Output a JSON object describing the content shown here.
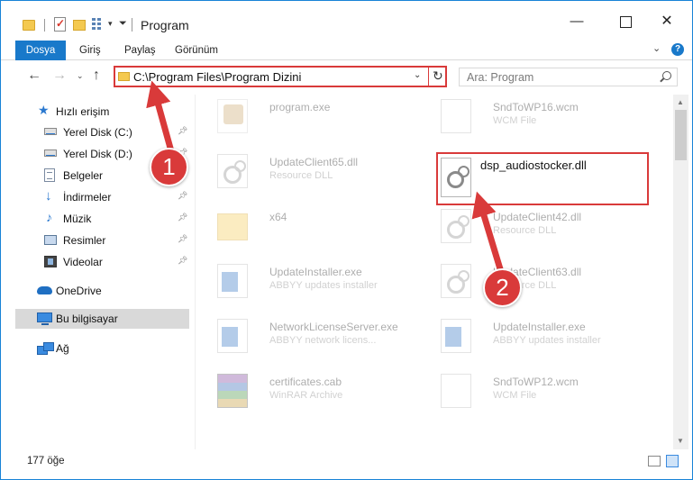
{
  "window": {
    "title": "Program",
    "minimize": "—",
    "close": "✕"
  },
  "ribbon": {
    "tabs": [
      "Dosya",
      "Giriş",
      "Paylaş",
      "Görünüm"
    ],
    "help": "?"
  },
  "nav": {
    "back": "←",
    "forward": "→",
    "recent": "⌄",
    "up": "↑",
    "address": "C:\\Program Files\\Program Dizini",
    "refresh": "↻",
    "search_placeholder": "Ara: Program"
  },
  "sidebar": {
    "quick_access": "Hızlı erişim",
    "items": [
      {
        "label": "Yerel Disk (C:)",
        "icon": "drive-icon",
        "pinned": true
      },
      {
        "label": "Yerel Disk (D:)",
        "icon": "drive-icon",
        "pinned": true
      },
      {
        "label": "Belgeler",
        "icon": "documents-icon",
        "pinned": true
      },
      {
        "label": "İndirmeler",
        "icon": "downloads-icon",
        "pinned": true
      },
      {
        "label": "Müzik",
        "icon": "music-icon",
        "pinned": true
      },
      {
        "label": "Resimler",
        "icon": "pictures-icon",
        "pinned": true
      },
      {
        "label": "Videolar",
        "icon": "videos-icon",
        "pinned": true
      }
    ],
    "onedrive": "OneDrive",
    "this_pc": "Bu bilgisayar",
    "network": "Ağ"
  },
  "files": [
    {
      "name": "program.exe",
      "type": "",
      "icon": "exe-icon"
    },
    {
      "name": "SndToWP16.wcm",
      "type": "WCM File",
      "icon": "page-icon"
    },
    {
      "name": "UpdateClient65.dll",
      "type": "Resource DLL",
      "icon": "dll-icon"
    },
    {
      "name": "dsp_audiostocker.dll",
      "type": "",
      "icon": "dll-icon"
    },
    {
      "name": "x64",
      "type": "",
      "icon": "folder-icon"
    },
    {
      "name": "UpdateClient42.dll",
      "type": "Resource DLL",
      "icon": "dll-icon"
    },
    {
      "name": "UpdateInstaller.exe",
      "type": "ABBYY updates installer",
      "icon": "installer-icon"
    },
    {
      "name": "UpdateClient63.dll",
      "type": "Resource DLL",
      "icon": "dll-icon"
    },
    {
      "name": "NetworkLicenseServer.exe",
      "type": "ABBYY network licens...",
      "icon": "installer-icon"
    },
    {
      "name": "UpdateInstaller.exe",
      "type": "ABBYY updates installer",
      "icon": "installer-icon"
    },
    {
      "name": "certificates.cab",
      "type": "WinRAR Archive",
      "icon": "archive-icon"
    },
    {
      "name": "SndToWP12.wcm",
      "type": "WCM File",
      "icon": "page-icon"
    }
  ],
  "status": {
    "item_count": "177 öğe"
  },
  "annotations": {
    "step1": "1",
    "step2": "2"
  },
  "colors": {
    "accent": "#1979ca",
    "annotation_red": "#d93a3a"
  }
}
